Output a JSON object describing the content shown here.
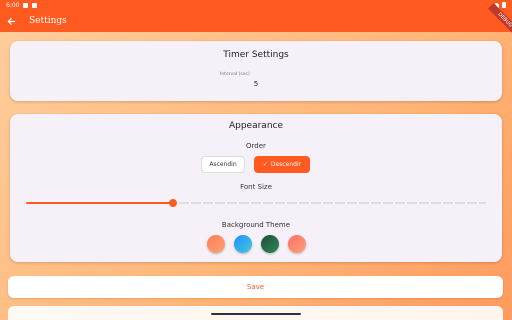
{
  "status_bar": {
    "time": "6:00"
  },
  "app_bar": {
    "title": "Settings",
    "back_icon": "arrow-back-icon",
    "debug_label": "DEBUG"
  },
  "timer_card": {
    "title": "Timer Settings",
    "interval_label": "Interval (sec)",
    "interval_value": "5"
  },
  "appearance_card": {
    "title": "Appearance",
    "order_label": "Order",
    "order_options": [
      "Ascendin",
      "Descendir"
    ],
    "selected_order": "Descendir",
    "font_size_label": "Font Size",
    "font_size_fraction": 0.32,
    "background_label": "Background Theme",
    "themes": [
      {
        "name": "theme-orange",
        "colors": [
          "#ff7f50",
          "#ffa07a"
        ]
      },
      {
        "name": "theme-blue",
        "colors": [
          "#1e90ff",
          "#48c9d9"
        ]
      },
      {
        "name": "theme-green",
        "colors": [
          "#1f4d3a",
          "#2e8b57"
        ]
      },
      {
        "name": "theme-peach",
        "colors": [
          "#ff6f61",
          "#ffa07a"
        ]
      }
    ]
  },
  "save_label": "Save",
  "accent_color": "#ff5a1f"
}
